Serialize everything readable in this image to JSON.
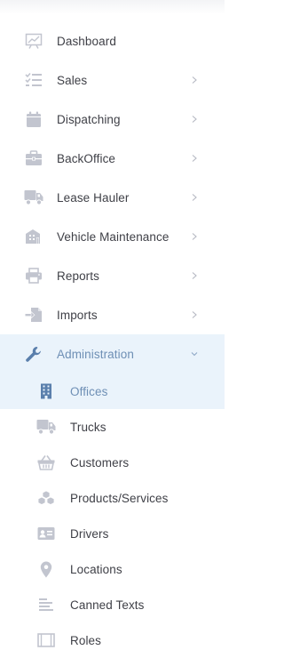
{
  "menu": {
    "items": [
      {
        "label": "Dashboard",
        "icon": "dashboard-chart-icon"
      },
      {
        "label": "Sales",
        "icon": "checklist-icon"
      },
      {
        "label": "Dispatching",
        "icon": "calendar-icon"
      },
      {
        "label": "BackOffice",
        "icon": "briefcase-icon"
      },
      {
        "label": "Lease Hauler",
        "icon": "truck-icon"
      },
      {
        "label": "Vehicle Maintenance",
        "icon": "vehicle-maintenance-icon"
      },
      {
        "label": "Reports",
        "icon": "printer-icon"
      },
      {
        "label": "Imports",
        "icon": "import-icon"
      },
      {
        "label": "Administration",
        "icon": "wrench-icon"
      }
    ],
    "submenu": [
      {
        "label": "Offices",
        "icon": "building-icon"
      },
      {
        "label": "Trucks",
        "icon": "truck-icon"
      },
      {
        "label": "Customers",
        "icon": "basket-icon"
      },
      {
        "label": "Products/Services",
        "icon": "cubes-icon"
      },
      {
        "label": "Drivers",
        "icon": "id-card-icon"
      },
      {
        "label": "Locations",
        "icon": "map-marker-icon"
      },
      {
        "label": "Canned Texts",
        "icon": "text-lines-icon"
      },
      {
        "label": "Roles",
        "icon": "window-icon"
      }
    ]
  },
  "colors": {
    "icon": "#c2c5cf",
    "label": "#3f4047",
    "active_bg": "#eaf3fb",
    "active_text": "#6e8fb5",
    "active_icon": "#5a7fac"
  }
}
